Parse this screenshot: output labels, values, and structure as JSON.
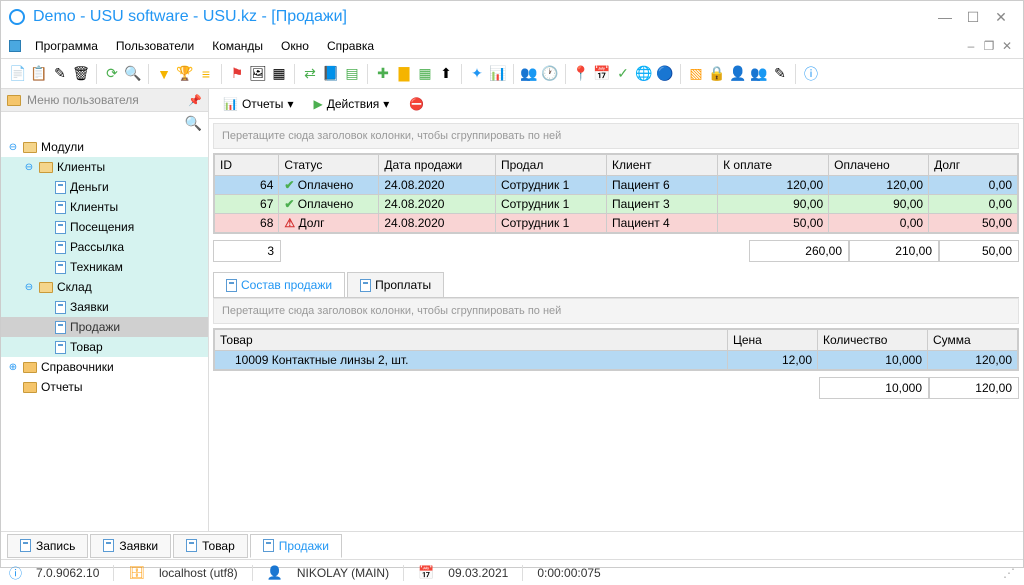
{
  "title": "Demo - USU software - USU.kz - [Продажи]",
  "menu": [
    "Программа",
    "Пользователи",
    "Команды",
    "Окно",
    "Справка"
  ],
  "sidebar": {
    "header": "Меню пользователя",
    "nodes": {
      "modules": "Модули",
      "clients": "Клиенты",
      "money": "Деньги",
      "clients2": "Клиенты",
      "visits": "Посещения",
      "mailing": "Рассылка",
      "tech": "Техникам",
      "stock": "Склад",
      "orders": "Заявки",
      "sales": "Продажи",
      "product": "Товар",
      "refs": "Справочники",
      "reports": "Отчеты"
    }
  },
  "subtoolbar": {
    "reports": "Отчеты",
    "actions": "Действия"
  },
  "grid": {
    "hint": "Перетащите сюда заголовок колонки, чтобы сгруппировать по ней",
    "cols": [
      "ID",
      "Статус",
      "Дата продажи",
      "Продал",
      "Клиент",
      "К оплате",
      "Оплачено",
      "Долг"
    ],
    "rows": [
      {
        "id": "64",
        "status": "Оплачено",
        "date": "24.08.2020",
        "seller": "Сотрудник 1",
        "client": "Пациент 6",
        "due": "120,00",
        "paid": "120,00",
        "debt": "0,00",
        "kind": "paid",
        "sel": true
      },
      {
        "id": "67",
        "status": "Оплачено",
        "date": "24.08.2020",
        "seller": "Сотрудник 1",
        "client": "Пациент 3",
        "due": "90,00",
        "paid": "90,00",
        "debt": "0,00",
        "kind": "paid"
      },
      {
        "id": "68",
        "status": "Долг",
        "date": "24.08.2020",
        "seller": "Сотрудник 1",
        "client": "Пациент 4",
        "due": "50,00",
        "paid": "0,00",
        "debt": "50,00",
        "kind": "debt"
      }
    ],
    "totals": {
      "count": "3",
      "due": "260,00",
      "paid": "210,00",
      "debt": "50,00"
    }
  },
  "subtabs": {
    "a": "Состав продажи",
    "b": "Проплаты"
  },
  "detail": {
    "cols": [
      "Товар",
      "Цена",
      "Количество",
      "Сумма"
    ],
    "row": {
      "product": "10009 Контактные линзы 2, шт.",
      "price": "12,00",
      "qty": "10,000",
      "sum": "120,00"
    },
    "totals": {
      "qty": "10,000",
      "sum": "120,00"
    }
  },
  "bottomTabs": [
    "Запись",
    "Заявки",
    "Товар",
    "Продажи"
  ],
  "status": {
    "ver": "7.0.9062.10",
    "host": "localhost (utf8)",
    "user": "NIKOLAY (MAIN)",
    "date": "09.03.2021",
    "time": "0:00:00:075"
  }
}
